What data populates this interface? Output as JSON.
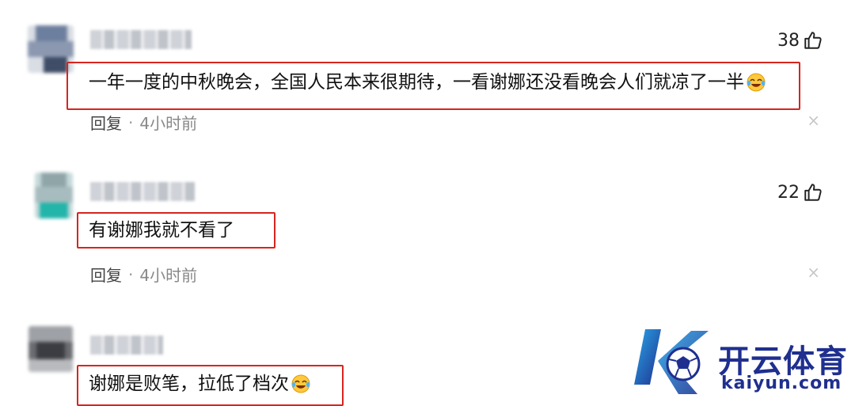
{
  "comments": [
    {
      "likes": "38",
      "text": "一年一度的中秋晚会，全国人民本来很期待，一看谢娜还没看晚会人们就凉了一半",
      "emoji": "laughing-crying-emoji",
      "reply": "回复",
      "dot": "·",
      "time": "4小时前",
      "close": "×"
    },
    {
      "likes": "22",
      "text": "有谢娜我就不看了",
      "reply": "回复",
      "dot": "·",
      "time": "4小时前",
      "close": "×"
    },
    {
      "text": "谢娜是败笔，拉低了档次",
      "emoji": "laughing-crying-emoji"
    }
  ],
  "watermark": {
    "brand_cn": "开云体育",
    "brand_en": "kaiyun.com"
  },
  "colors": {
    "highlight": "#d6251f",
    "brand": "#1f2f8f",
    "brand_accent": "#2aa7e8"
  }
}
